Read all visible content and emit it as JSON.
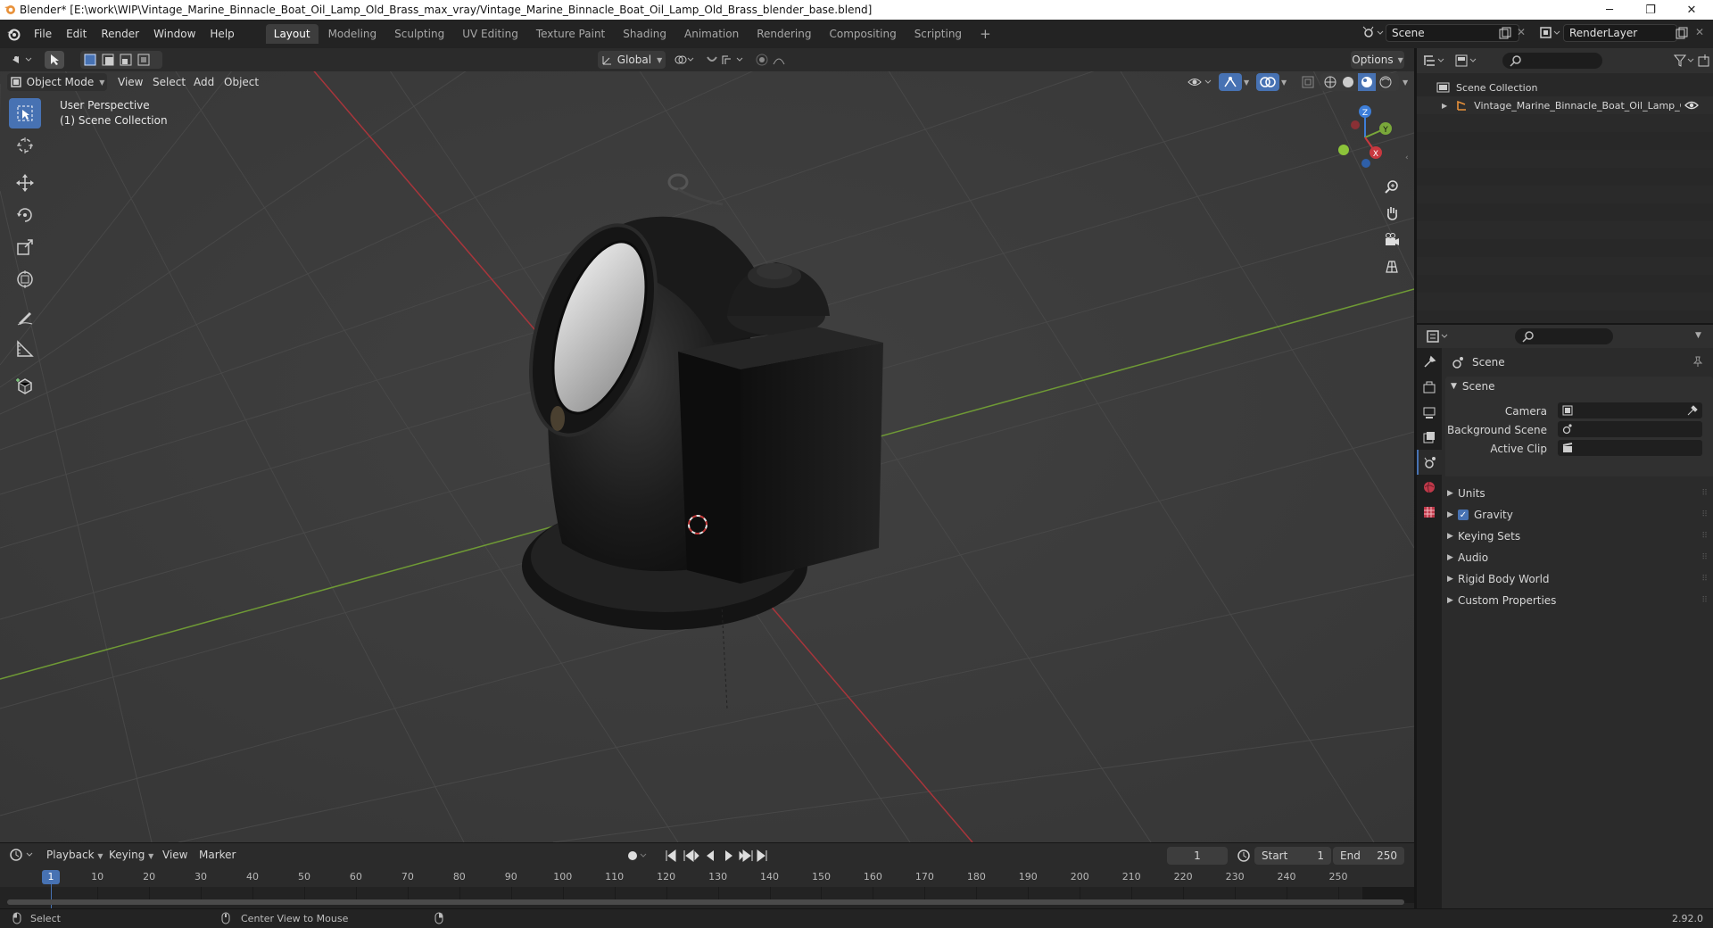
{
  "window": {
    "title": "Blender* [E:\\work\\WIP\\Vintage_Marine_Binnacle_Boat_Oil_Lamp_Old_Brass_max_vray/Vintage_Marine_Binnacle_Boat_Oil_Lamp_Old_Brass_blender_base.blend]",
    "minimize": "─",
    "restore": "❐",
    "close": "✕"
  },
  "menu": [
    "File",
    "Edit",
    "Render",
    "Window",
    "Help"
  ],
  "workspaces": [
    "Layout",
    "Modeling",
    "Sculpting",
    "UV Editing",
    "Texture Paint",
    "Shading",
    "Animation",
    "Rendering",
    "Compositing",
    "Scripting"
  ],
  "active_workspace": "Layout",
  "scene_name": "Scene",
  "render_layer": "RenderLayer",
  "viewport": {
    "transform_orientation": "Global",
    "options_label": "Options",
    "mode": "Object Mode",
    "header_menus": [
      "View",
      "Select",
      "Add",
      "Object"
    ],
    "overlay_line1": "User Perspective",
    "overlay_line2": "(1) Scene Collection",
    "gizmo": {
      "x": "X",
      "y": "Y",
      "z": "Z"
    }
  },
  "outliner": {
    "root": "Scene Collection",
    "object": "Vintage_Marine_Binnacle_Boat_Oil_Lamp_O"
  },
  "properties": {
    "context": "Scene",
    "panel": "Scene",
    "camera_label": "Camera",
    "background_label": "Background Scene",
    "clip_label": "Active Clip",
    "subpanels": [
      "Units",
      "Gravity",
      "Keying Sets",
      "Audio",
      "Rigid Body World",
      "Custom Properties"
    ],
    "gravity_checked": true
  },
  "timeline": {
    "menus": [
      "Playback",
      "Keying",
      "View",
      "Marker"
    ],
    "current_frame": "1",
    "start_label": "Start",
    "start": "1",
    "end_label": "End",
    "end": "250",
    "ticks": [
      "1",
      "10",
      "20",
      "30",
      "40",
      "50",
      "60",
      "70",
      "80",
      "90",
      "100",
      "110",
      "120",
      "130",
      "140",
      "150",
      "160",
      "170",
      "180",
      "190",
      "200",
      "210",
      "220",
      "230",
      "240",
      "250"
    ]
  },
  "status": {
    "left": "Select",
    "middle": "Center View to Mouse",
    "version": "2.92.0"
  },
  "colors": {
    "accent": "#4772b3",
    "x_axis": "#c8383f",
    "y_axis": "#7aa83a",
    "z_axis": "#3d7ed8",
    "orange": "#e8913a"
  }
}
